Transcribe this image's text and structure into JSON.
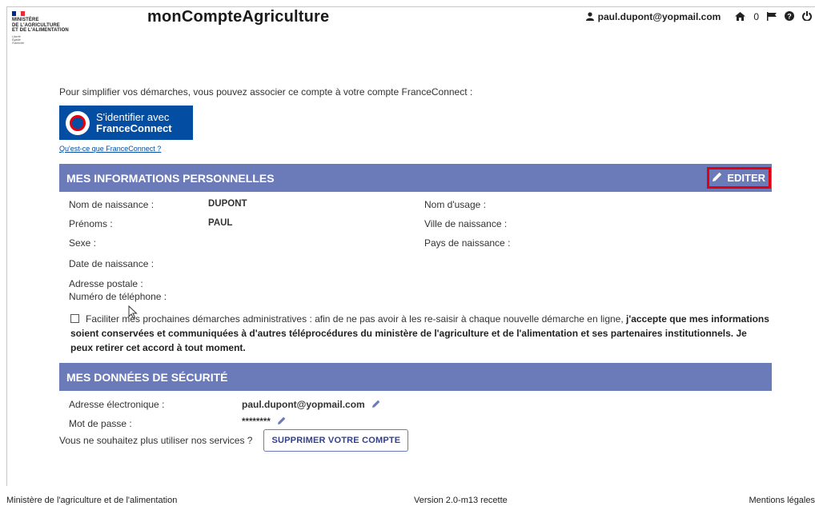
{
  "header": {
    "ministry_lines": [
      "MINISTÈRE",
      "DE L'AGRICULTURE",
      "ET DE L'ALIMENTATION"
    ],
    "motto_lines": [
      "Liberté",
      "Égalité",
      "Fraternité"
    ],
    "app_title": "monCompteAgriculture",
    "user_email": "paul.dupont@yopmail.com",
    "notification_count": "0",
    "icons": [
      "user-icon",
      "home-icon",
      "flag-icon",
      "help-icon",
      "power-icon"
    ],
    "flag_colors": [
      "#002395",
      "#ffffff",
      "#ed2939"
    ]
  },
  "franceconnect": {
    "intro": "Pour simplifier vos démarches, vous pouvez associer ce compte à votre compte FranceConnect :",
    "button_line1": "S'identifier avec",
    "button_line2": "FranceConnect",
    "link": "Qu'est-ce que FranceConnect ?"
  },
  "personal": {
    "title": "MES INFORMATIONS PERSONNELLES",
    "edit_label": "EDITER",
    "fields_left": [
      {
        "label": "Nom de naissance :",
        "value": "DUPONT"
      },
      {
        "label": "Prénoms :",
        "value": "PAUL"
      },
      {
        "label": "Sexe :",
        "value": ""
      },
      {
        "label": "Date de naissance :",
        "value": ""
      },
      {
        "label": "Adresse postale :",
        "value": ""
      },
      {
        "label": "Numéro de téléphone :",
        "value": ""
      }
    ],
    "fields_right": [
      {
        "label": "Nom d'usage :",
        "value": ""
      },
      {
        "label": "Ville de naissance :",
        "value": ""
      },
      {
        "label": "Pays de naissance :",
        "value": ""
      }
    ],
    "consent_text": "Faciliter mes prochaines démarches administratives : afin de ne pas avoir à les re-saisir à chaque nouvelle démarche en ligne, ",
    "consent_bold": "j'accepte que mes informations soient conservées et communiquées à d'autres téléprocédures du ministère de l'agriculture et de l'alimentation et ses partenaires institutionnels. Je peux retirer cet accord à tout moment."
  },
  "security": {
    "title": "MES DONNÉES DE SÉCURITÉ",
    "email_label": "Adresse électronique :",
    "email_value": "paul.dupont@yopmail.com",
    "password_label": "Mot de passe :",
    "password_value": "********",
    "delete_prompt": "Vous ne souhaitez plus utiliser nos services ?",
    "delete_button": "SUPPRIMER VOTRE COMPTE"
  },
  "footer": {
    "left": "Ministère de l'agriculture et de l'alimentation",
    "center": "Version 2.0-m13 recette",
    "right": "Mentions légales"
  },
  "colors": {
    "section_bar": "#6b7ab9",
    "franceconnect_blue": "#034ea2",
    "highlight_red": "#e1000f"
  }
}
